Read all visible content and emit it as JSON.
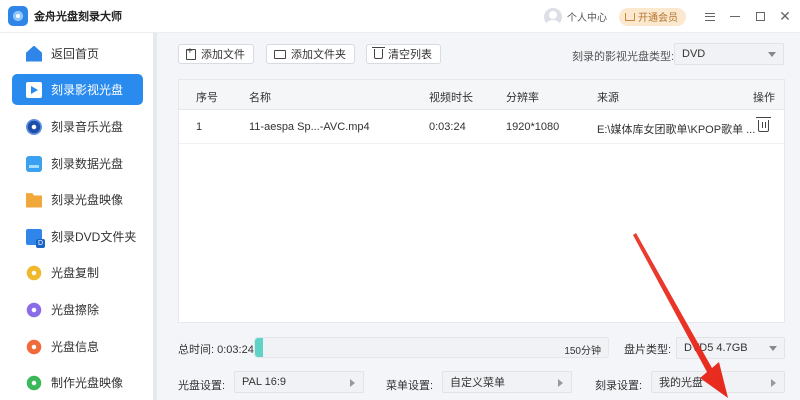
{
  "app": {
    "title": "金舟光盘刻录大师"
  },
  "header": {
    "user_center": "个人中心",
    "vip_button": "开通会员"
  },
  "sidebar": {
    "items": [
      {
        "label": "返回首页",
        "icon": "home-icon"
      },
      {
        "label": "刻录影视光盘",
        "icon": "video-disc-icon"
      },
      {
        "label": "刻录音乐光盘",
        "icon": "music-disc-icon"
      },
      {
        "label": "刻录数据光盘",
        "icon": "data-disc-icon"
      },
      {
        "label": "刻录光盘映像",
        "icon": "disc-image-icon"
      },
      {
        "label": "刻录DVD文件夹",
        "icon": "dvd-folder-icon"
      },
      {
        "label": "光盘复制",
        "icon": "disc-copy-icon"
      },
      {
        "label": "光盘擦除",
        "icon": "disc-erase-icon"
      },
      {
        "label": "光盘信息",
        "icon": "disc-info-icon"
      },
      {
        "label": "制作光盘映像",
        "icon": "make-image-icon"
      }
    ],
    "active_index": 1
  },
  "toolbar": {
    "add_file": "添加文件",
    "add_folder": "添加文件夹",
    "clear_list": "清空列表",
    "disc_type_label": "刻录的影视光盘类型:",
    "disc_type_value": "DVD"
  },
  "table": {
    "columns": [
      "序号",
      "名称",
      "视频时长",
      "分辨率",
      "来源",
      "操作"
    ],
    "rows": [
      {
        "index": "1",
        "name": "11-aespa Sp...-AVC.mp4",
        "duration": "0:03:24",
        "resolution": "1920*1080",
        "source": "E:\\媒体库女团歌单\\KPOP歌单 ..."
      }
    ]
  },
  "footer": {
    "total_label": "总时间: 0:03:24",
    "capacity_label": "150分钟",
    "progress_fraction": 0.02,
    "disc_spec_label": "盘片类型:",
    "disc_spec_value": "DVD5 4.7GB",
    "disc_setting_label": "光盘设置:",
    "disc_setting_value": "PAL 16:9",
    "menu_setting_label": "菜单设置:",
    "menu_setting_value": "自定义菜单",
    "burn_setting_label": "刻录设置:",
    "burn_setting_value": "我的光盘"
  },
  "colors": {
    "accent": "#2a8bef",
    "progress": "#5fd4c6",
    "annotation": "#e8291c"
  }
}
